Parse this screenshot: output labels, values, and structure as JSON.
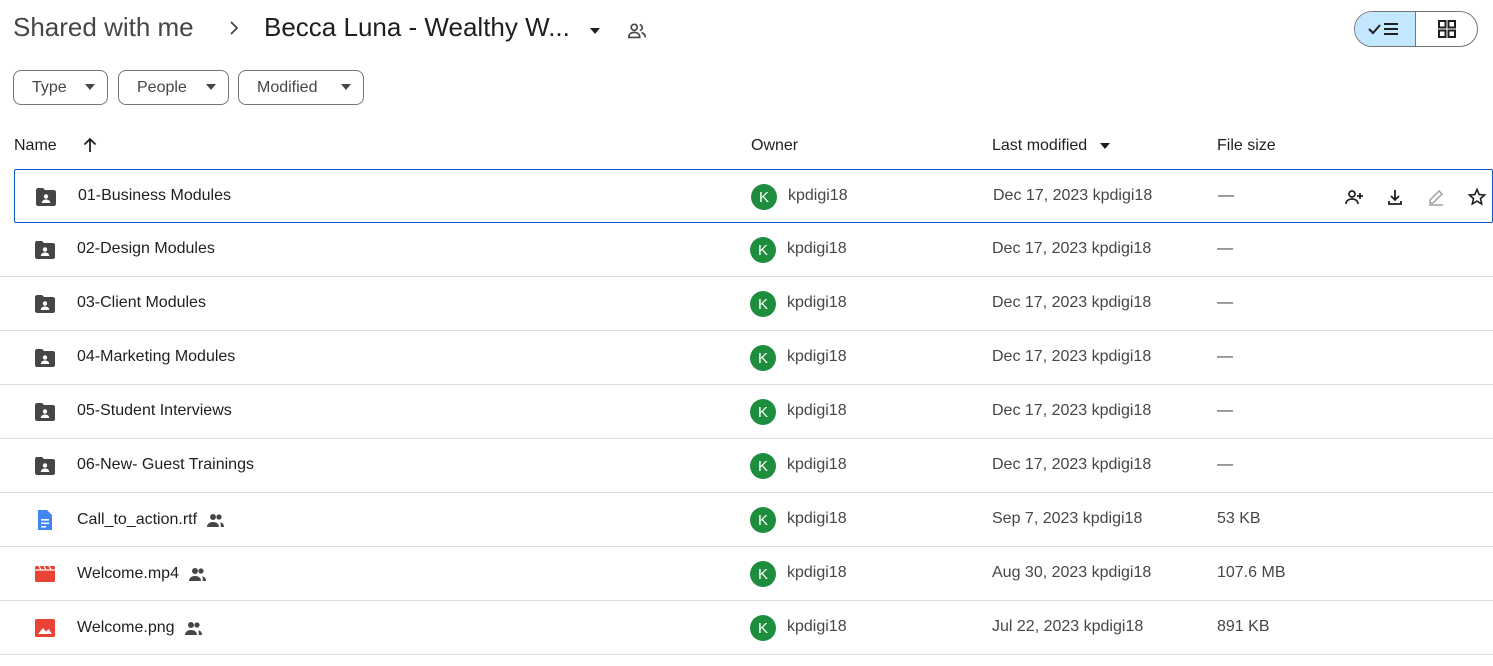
{
  "breadcrumb": {
    "root": "Shared with me",
    "current": "Becca Luna - Wealthy W..."
  },
  "filters": [
    "Type",
    "People",
    "Modified"
  ],
  "columns": {
    "name": "Name",
    "owner": "Owner",
    "last_modified": "Last modified",
    "file_size": "File size"
  },
  "colors": {
    "accent": "#0b57d0",
    "toggle_on": "#c2e7ff",
    "avatar": "#1e8e3e",
    "doc_icon": "#4285f4",
    "video_icon": "#ea4335",
    "image_icon": "#ea4335",
    "folder_icon": "#444746"
  },
  "rows": [
    {
      "name": "01-Business Modules",
      "type": "shared-folder-icon",
      "avatar": "K",
      "owner": "kpdigi18",
      "modified": "Dec 17, 2023 kpdigi18",
      "size": "—",
      "shared": false
    },
    {
      "name": "02-Design Modules",
      "type": "shared-folder-icon",
      "avatar": "K",
      "owner": "kpdigi18",
      "modified": "Dec 17, 2023 kpdigi18",
      "size": "—",
      "shared": false
    },
    {
      "name": "03-Client Modules",
      "type": "shared-folder-icon",
      "avatar": "K",
      "owner": "kpdigi18",
      "modified": "Dec 17, 2023 kpdigi18",
      "size": "—",
      "shared": false
    },
    {
      "name": "04-Marketing Modules",
      "type": "shared-folder-icon",
      "avatar": "K",
      "owner": "kpdigi18",
      "modified": "Dec 17, 2023 kpdigi18",
      "size": "—",
      "shared": false
    },
    {
      "name": "05-Student Interviews",
      "type": "shared-folder-icon",
      "avatar": "K",
      "owner": "kpdigi18",
      "modified": "Dec 17, 2023 kpdigi18",
      "size": "—",
      "shared": false
    },
    {
      "name": "06-New- Guest Trainings",
      "type": "shared-folder-icon",
      "avatar": "K",
      "owner": "kpdigi18",
      "modified": "Dec 17, 2023 kpdigi18",
      "size": "—",
      "shared": false
    },
    {
      "name": "Call_to_action.rtf",
      "type": "document-icon",
      "avatar": "K",
      "owner": "kpdigi18",
      "modified": "Sep 7, 2023 kpdigi18",
      "size": "53 KB",
      "shared": true
    },
    {
      "name": "Welcome.mp4",
      "type": "video-icon",
      "avatar": "K",
      "owner": "kpdigi18",
      "modified": "Aug 30, 2023 kpdigi18",
      "size": "107.6 MB",
      "shared": true
    },
    {
      "name": "Welcome.png",
      "type": "image-icon",
      "avatar": "K",
      "owner": "kpdigi18",
      "modified": "Jul 22, 2023 kpdigi18",
      "size": "891 KB",
      "shared": true
    }
  ],
  "row_actions": [
    "share-icon",
    "download-icon",
    "rename-icon",
    "star-icon"
  ]
}
